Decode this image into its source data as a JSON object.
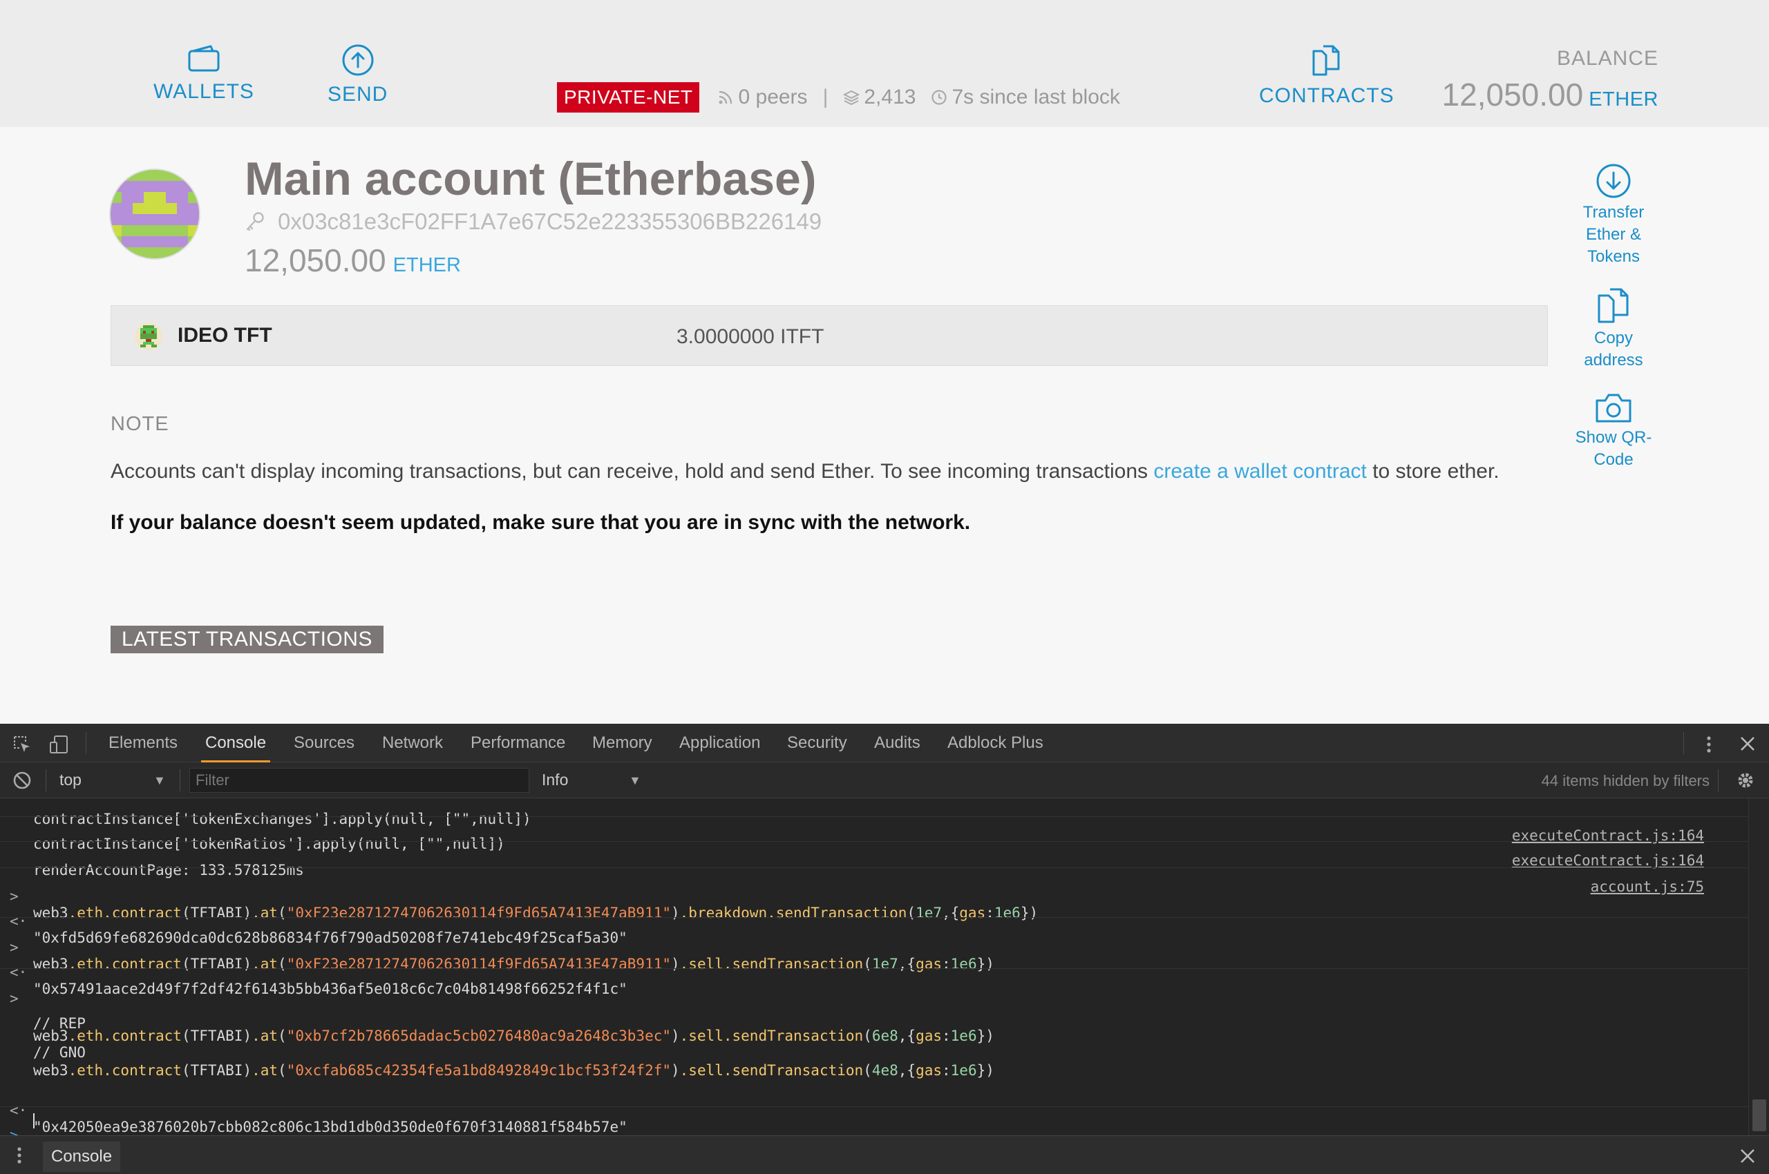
{
  "nav": {
    "wallets_label": "WALLETS",
    "send_label": "SEND",
    "contracts_label": "CONTRACTS"
  },
  "network": {
    "badge": "PRIVATE-NET",
    "peers": "0 peers",
    "separator": "|",
    "block": "2,413",
    "since_last_block": "7s since last block",
    "badge_color": "#d0021b"
  },
  "balance": {
    "label": "BALANCE",
    "value": "12,050.00",
    "unit": "ETHER"
  },
  "account": {
    "title": "Main account (Etherbase)",
    "address": "0x03c81e3cF02FF1A7e67C52e223355306BB226149",
    "balance_value": "12,050.00",
    "balance_unit": "ETHER"
  },
  "token": {
    "name": "IDEO TFT",
    "amount": "3.0000000 ITFT"
  },
  "actions": {
    "transfer_line1": "Transfer",
    "transfer_line2": "Ether &",
    "transfer_line3": "Tokens",
    "copy_line1": "Copy",
    "copy_line2": "address",
    "qr_line1": "Show QR-",
    "qr_line2": "Code"
  },
  "note": {
    "heading": "NOTE",
    "text_before": "Accounts can't display incoming transactions, but can receive, hold and send Ether. To see incoming transactions ",
    "link_text": "create a wallet contract",
    "text_after": " to store ether.",
    "bold_text": "If your balance doesn't seem updated, make sure that you are in sync with the network."
  },
  "latest_transactions_label": "LATEST TRANSACTIONS",
  "devtools": {
    "tabs": [
      "Elements",
      "Console",
      "Sources",
      "Network",
      "Performance",
      "Memory",
      "Application",
      "Security",
      "Audits",
      "Adblock Plus"
    ],
    "active_tab": "Console",
    "context": "top",
    "filter_placeholder": "Filter",
    "level": "Info",
    "hidden_count": "44 items hidden by filters",
    "drawer_tab": "Console",
    "console": {
      "l1_text": "contractInstance['tokenExchanges'].apply(null, [\"\",null])",
      "l1_src": "executeContract.js:164",
      "l2_text": "contractInstance['tokenRatios'].apply(null, [\"\",null])",
      "l2_src": "executeContract.js:164",
      "l3_text": "renderAccountPage: 133.578125ms",
      "l3_src": "account.js:75",
      "c1": {
        "a": "web3",
        "b": ".eth.contract",
        "c": "(TFTABI)",
        "d": ".at",
        "e": "(",
        "f": "\"0xF23e28712747062630114f9Fd65A7413E47aB911\"",
        "g": ")",
        "h": ".breakdown.sendTransaction",
        "i": "(",
        "j": "1e7",
        "k": ",{",
        "l": "gas",
        "m": ":",
        "n": "1e6",
        "o": "})"
      },
      "r1": "\"0xfd5d69fe682690dca0dc628b86834f76f790ad50208f7e741ebc49f25caf5a30\"",
      "c2": {
        "a": "web3",
        "b": ".eth.contract",
        "c": "(TFTABI)",
        "d": ".at",
        "e": "(",
        "f": "\"0xF23e28712747062630114f9Fd65A7413E47aB911\"",
        "g": ")",
        "h": ".sell.sendTransaction",
        "i": "(",
        "j": "1e7",
        "k": ",{",
        "l": "gas",
        "m": ":",
        "n": "1e6",
        "o": "})"
      },
      "r2": "\"0x57491aace2d49f7f2df42f6143b5bb436af5e018c6c7c04b81498f66252f4f1c\"",
      "cmt_rep": "// REP",
      "c3": {
        "a": "web3",
        "b": ".eth.contract",
        "c": "(TFTABI)",
        "d": ".at",
        "e": "(",
        "f": "\"0xb7cf2b78665dadac5cb0276480ac9a2648c3b3ec\"",
        "g": ")",
        "h": ".sell.sendTransaction",
        "i": "(",
        "j": "6e8",
        "k": ",{",
        "l": "gas",
        "m": ":",
        "n": "1e6",
        "o": "})"
      },
      "cmt_gno": "// GNO",
      "c4": {
        "a": "web3",
        "b": ".eth.contract",
        "c": "(TFTABI)",
        "d": ".at",
        "e": "(",
        "f": "\"0xcfab685c42354fe5a1bd8492849c1bcf53f24f2f\"",
        "g": ")",
        "h": ".sell.sendTransaction",
        "i": "(",
        "j": "4e8",
        "k": ",{",
        "l": "gas",
        "m": ":",
        "n": "1e6",
        "o": "})"
      },
      "r3": "\"0x42050ea9e3876020b7cbb082c806c13bd1db0d350de0f670f3140881f584b57e\"",
      "input_prefix": ">",
      "output_prefix": "<·"
    }
  },
  "colors": {
    "accent": "#1a8ec9",
    "link": "#3aa7dd",
    "badge": "#d0021b",
    "latest_bg": "#7d7676",
    "devtools_active": "#f49b2c"
  }
}
